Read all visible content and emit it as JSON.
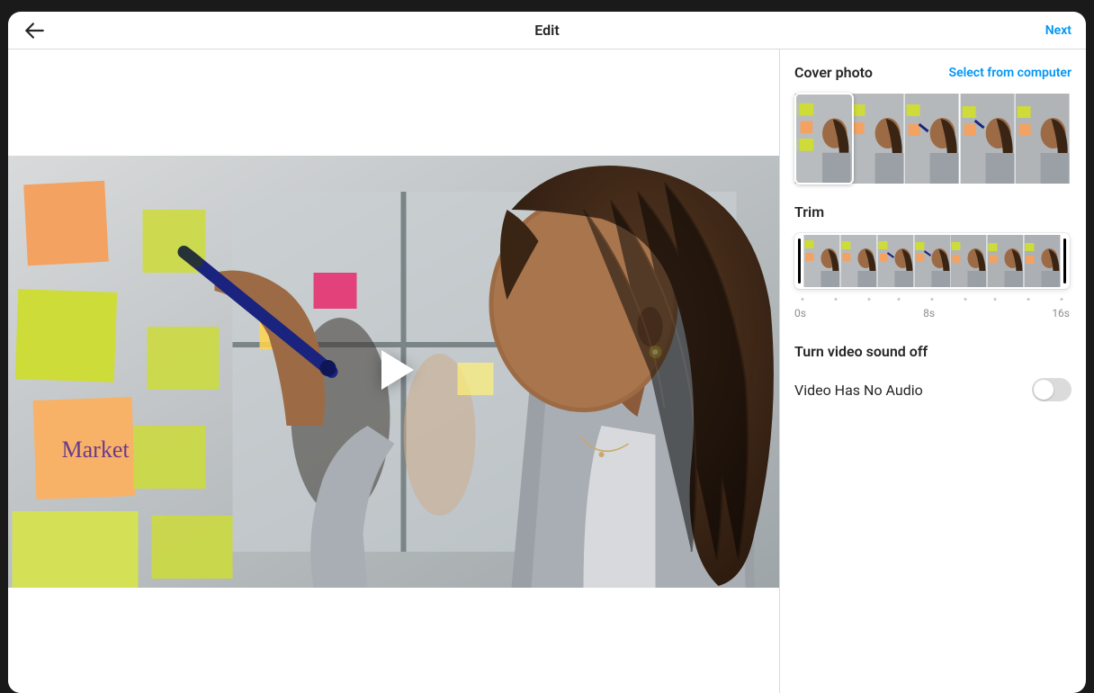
{
  "header": {
    "title": "Edit",
    "next_label": "Next"
  },
  "sidebar": {
    "cover_photo_label": "Cover photo",
    "select_from_computer_label": "Select from computer",
    "trim_label": "Trim",
    "trim_ticks": {
      "start": "0s",
      "mid": "8s",
      "end": "16s"
    },
    "sound_section_label": "Turn video sound off",
    "sound_toggle_label": "Video Has No Audio",
    "sound_toggle_on": false
  }
}
